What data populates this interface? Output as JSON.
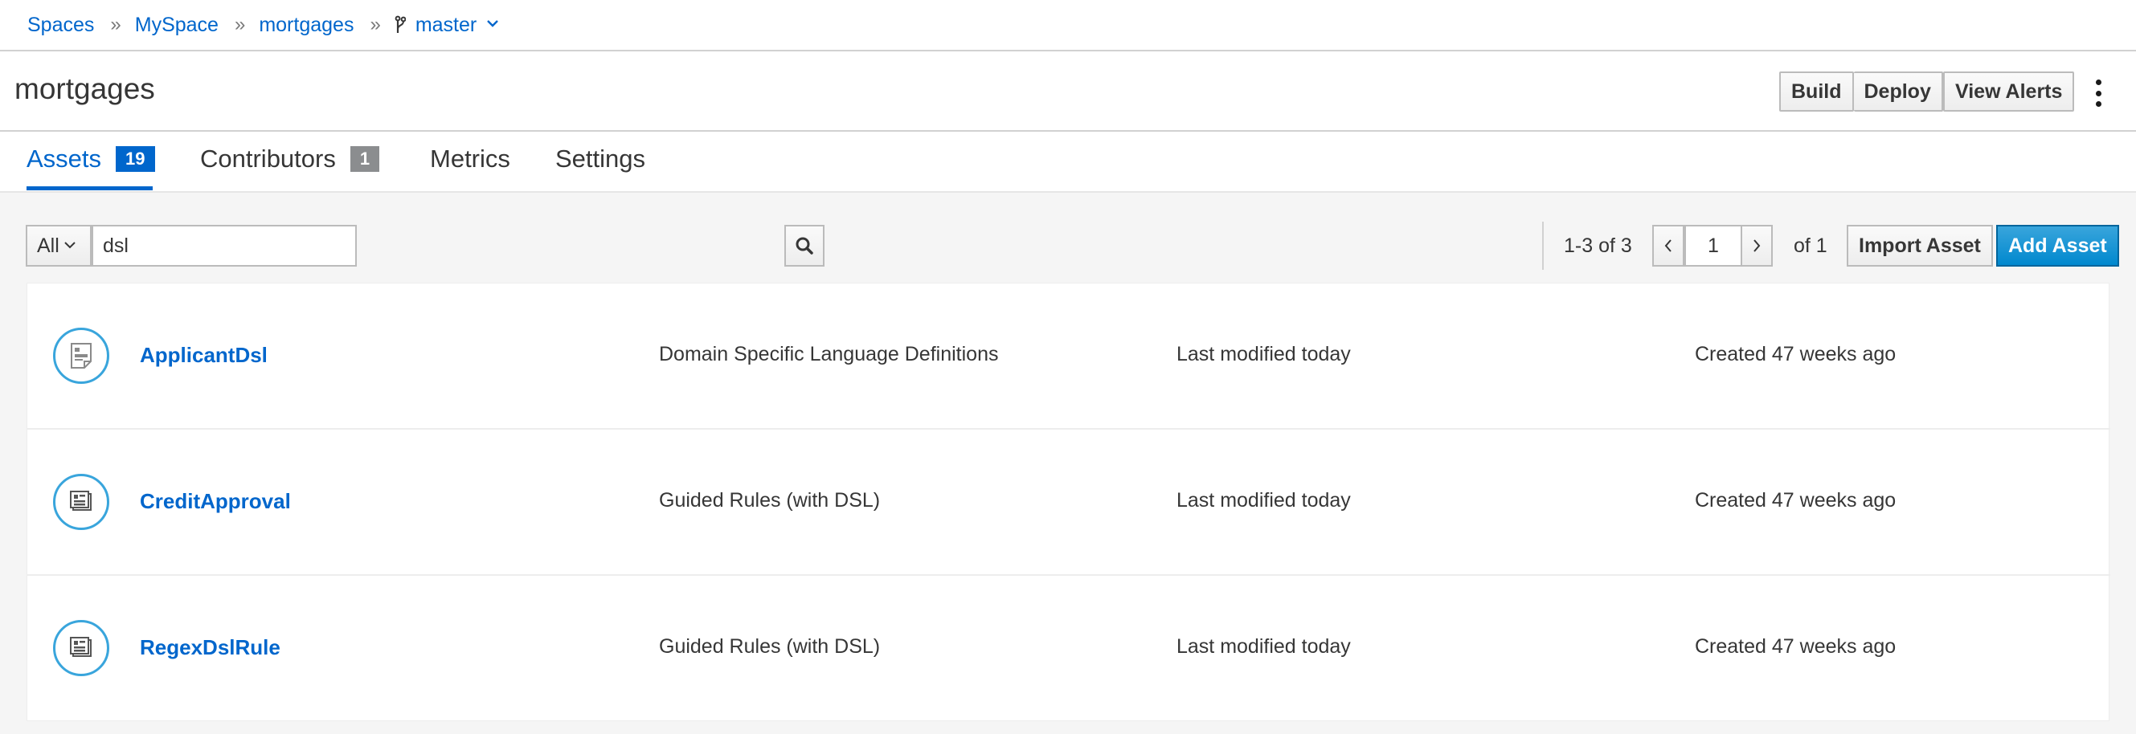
{
  "breadcrumb": {
    "items": [
      "Spaces",
      "MySpace",
      "mortgages"
    ],
    "branch": "master"
  },
  "header": {
    "title": "mortgages",
    "build_label": "Build",
    "deploy_label": "Deploy",
    "view_alerts_label": "View Alerts"
  },
  "tabs": [
    {
      "label": "Assets",
      "badge": "19",
      "active": true
    },
    {
      "label": "Contributors",
      "badge": "1"
    },
    {
      "label": "Metrics"
    },
    {
      "label": "Settings"
    }
  ],
  "toolbar": {
    "filter_value": "All",
    "search_value": "dsl",
    "count_text": "1-3 of 3",
    "page_value": "1",
    "of_text": "of 1",
    "import_label": "Import Asset",
    "add_label": "Add Asset"
  },
  "assets": [
    {
      "name": "ApplicantDsl",
      "type": "Domain Specific Language Definitions",
      "modified": "Last modified today",
      "created": "Created 47 weeks ago",
      "icon": "dsl-definition-icon"
    },
    {
      "name": "CreditApproval",
      "type": "Guided Rules (with DSL)",
      "modified": "Last modified today",
      "created": "Created 47 weeks ago",
      "icon": "guided-rule-icon"
    },
    {
      "name": "RegexDslRule",
      "type": "Guided Rules (with DSL)",
      "modified": "Last modified today",
      "created": "Created 47 weeks ago",
      "icon": "guided-rule-icon"
    }
  ],
  "colors": {
    "link": "#0066cc",
    "primary_button": "#0088ce",
    "icon_ring": "#39a5dc",
    "badge_grey": "#8b8d8f"
  }
}
